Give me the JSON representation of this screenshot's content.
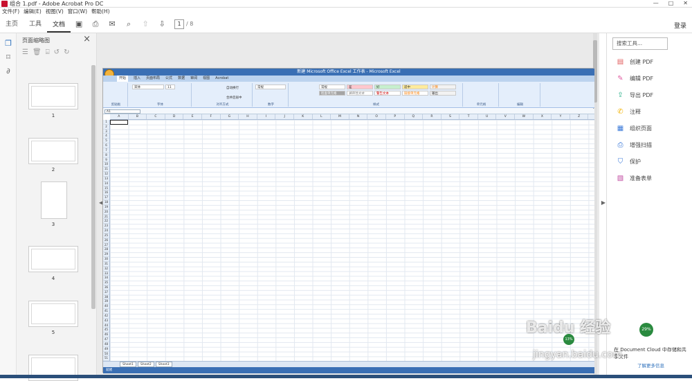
{
  "window": {
    "title": "组合 1.pdf - Adobe Acrobat Pro DC",
    "minimize": "—",
    "maximize": "□",
    "close": "✕"
  },
  "menu": [
    "文件(F)",
    "编辑(E)",
    "视图(V)",
    "窗口(W)",
    "帮助(H)"
  ],
  "toolbar": {
    "tabs": [
      "主页",
      "工具",
      "文档"
    ],
    "active_tab": "文档",
    "page_current": "1",
    "page_total": "/ 8",
    "login": "登录"
  },
  "thumbnails": {
    "title": "页面缩略图",
    "pages": [
      "1",
      "2",
      "3",
      "4",
      "5"
    ]
  },
  "excel": {
    "title": "新建 Microsoft Office Excel 工作表 - Microsoft Excel",
    "tabs": [
      "开始",
      "插入",
      "页面布局",
      "公式",
      "数据",
      "审阅",
      "视图",
      "Acrobat"
    ],
    "font_name": "宋体",
    "font_size": "11",
    "number_format": "常规",
    "wrap_text": "自动换行",
    "merge_center": "合并后居中",
    "styles": [
      "常规",
      "差",
      "好",
      "适中",
      "计算",
      "检查单元格",
      "解释性文本",
      "警告文本",
      "链接单元格",
      "输出"
    ],
    "group_labels": [
      "剪贴板",
      "字体",
      "对齐方式",
      "数字",
      "样式",
      "单元格",
      "编辑"
    ],
    "name_box": "A1",
    "columns": [
      "A",
      "B",
      "C",
      "D",
      "E",
      "F",
      "G",
      "H",
      "I",
      "J",
      "K",
      "L",
      "M",
      "N",
      "O",
      "P",
      "Q",
      "R",
      "S",
      "T",
      "U",
      "V",
      "W",
      "X",
      "Y",
      "Z"
    ],
    "rows": [
      "1",
      "2",
      "3",
      "4",
      "5",
      "6",
      "7",
      "8",
      "9",
      "10",
      "11",
      "12",
      "13",
      "14",
      "15",
      "16",
      "17",
      "18",
      "19",
      "20",
      "21",
      "22",
      "23",
      "24",
      "25",
      "26",
      "27",
      "28",
      "29",
      "30",
      "31",
      "32",
      "33",
      "34",
      "35",
      "36",
      "37",
      "38",
      "39",
      "40",
      "41",
      "42",
      "43",
      "44",
      "45",
      "46",
      "47",
      "48",
      "49",
      "50",
      "51",
      "52"
    ],
    "sheets": [
      "Sheet1",
      "Sheet2",
      "Sheet3"
    ],
    "status": "就绪",
    "zoom_badge": "13%"
  },
  "right_panel": {
    "search_placeholder": "搜索工具...",
    "tools": [
      {
        "label": "创建 PDF",
        "icon": "create-pdf-icon",
        "color": "#e05a5a"
      },
      {
        "label": "编辑 PDF",
        "icon": "edit-pdf-icon",
        "color": "#e05aa0"
      },
      {
        "label": "导出 PDF",
        "icon": "export-pdf-icon",
        "color": "#2bb08a"
      },
      {
        "label": "注释",
        "icon": "comment-icon",
        "color": "#f2b200"
      },
      {
        "label": "组织页面",
        "icon": "organize-pages-icon",
        "color": "#3b7ad9"
      },
      {
        "label": "增强扫描",
        "icon": "enhance-scan-icon",
        "color": "#3b7ad9"
      },
      {
        "label": "保护",
        "icon": "protect-icon",
        "color": "#3b7ad9"
      },
      {
        "label": "准备表单",
        "icon": "prepare-form-icon",
        "color": "#c04aa0"
      }
    ],
    "cloud_text": "在 Document Cloud 中存储和共享文件",
    "cloud_link": "了解更多信息"
  },
  "watermark": {
    "brand": "Baidu 经验",
    "url": "jingyan.baidu.com"
  },
  "float_badge": "29%"
}
